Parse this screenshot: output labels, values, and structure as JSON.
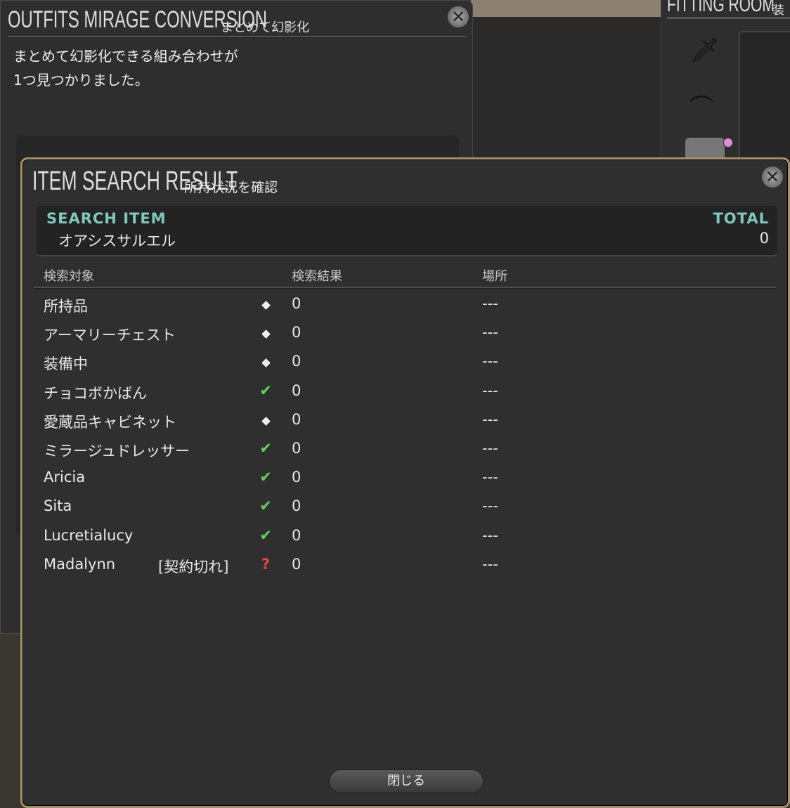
{
  "background_window": {
    "title": "OUTFITS MIRAGE CONVERSION",
    "subtitle": "まとめて幻影化",
    "message_line1": "まとめて幻影化できる組み合わせが",
    "message_line2": "1つ見つかりました。"
  },
  "fitting_room": {
    "title": "FITTING ROOM",
    "subtitle": "装"
  },
  "dialog": {
    "title": "ITEM SEARCH RESULT",
    "subtitle": "所持状況を確認",
    "search_item_label": "SEARCH ITEM",
    "search_item_name": "オアシスサルエル",
    "total_label": "TOTAL",
    "total_value": "0",
    "columns": {
      "target": "検索対象",
      "result": "検索結果",
      "location": "場所"
    },
    "rows": [
      {
        "name": "所持品",
        "extra": "",
        "icon": "diamond",
        "count": "0",
        "location": "---"
      },
      {
        "name": "アーマリーチェスト",
        "extra": "",
        "icon": "diamond",
        "count": "0",
        "location": "---"
      },
      {
        "name": "装備中",
        "extra": "",
        "icon": "diamond",
        "count": "0",
        "location": "---"
      },
      {
        "name": "チョコボかばん",
        "extra": "",
        "icon": "check",
        "count": "0",
        "location": "---"
      },
      {
        "name": "愛蔵品キャビネット",
        "extra": "",
        "icon": "diamond",
        "count": "0",
        "location": "---"
      },
      {
        "name": "ミラージュドレッサー",
        "extra": "",
        "icon": "check",
        "count": "0",
        "location": "---"
      },
      {
        "name": "Aricia",
        "extra": "",
        "icon": "check",
        "count": "0",
        "location": "---"
      },
      {
        "name": "Sita",
        "extra": "",
        "icon": "check",
        "count": "0",
        "location": "---"
      },
      {
        "name": "Lucretialucy",
        "extra": "",
        "icon": "check",
        "count": "0",
        "location": "---"
      },
      {
        "name": "Madalynn",
        "extra": "[契約切れ]",
        "icon": "question",
        "count": "0",
        "location": "---"
      }
    ],
    "close_label": "閉じる"
  },
  "colors": {
    "accent_teal": "#7dc9bd",
    "border_gold": "#a8916a",
    "check_green": "#5fd35f",
    "question_red": "#e04b3b"
  }
}
